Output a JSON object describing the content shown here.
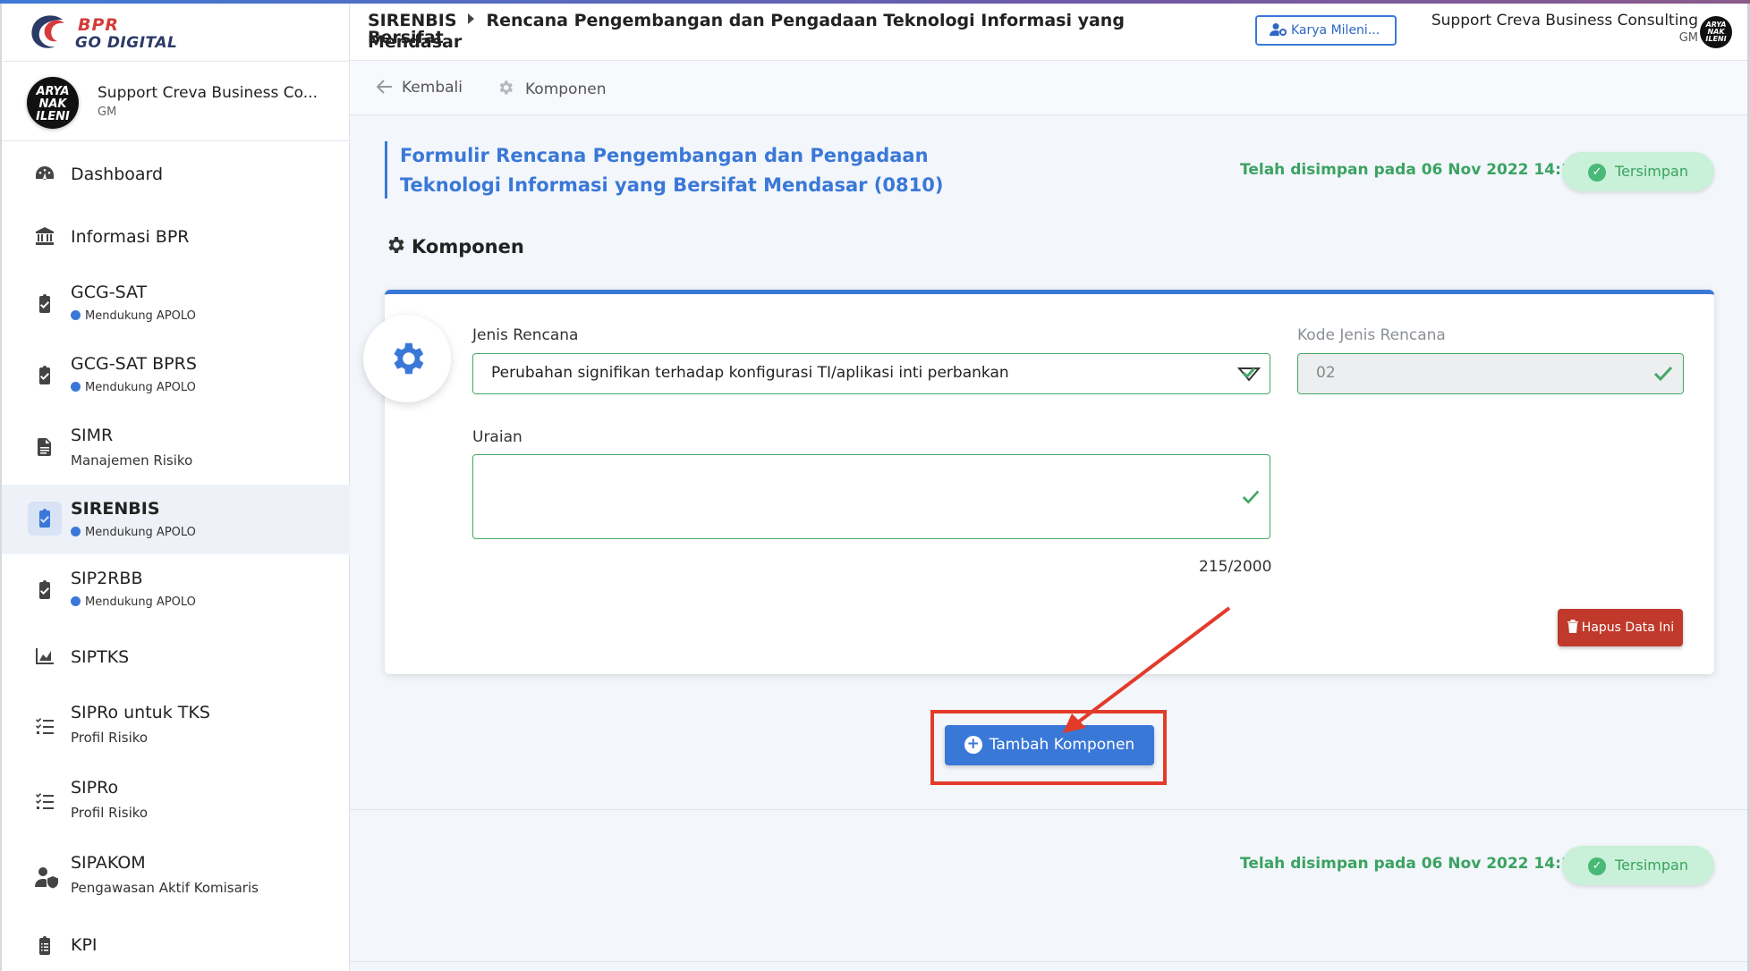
{
  "app": {
    "logo_line1": "BPR",
    "logo_line2": "GO DIGITAL"
  },
  "header": {
    "breadcrumb_root": "SIRENBIS",
    "breadcrumb_title_line1": "Rencana Pengembangan dan Pengadaan Teknologi Informasi yang Bersifat",
    "breadcrumb_title_line2": "Mendasar",
    "org_button": "Karya Mileni...",
    "user_name": "Support Creva Business Consulting",
    "user_role": "GM",
    "avatar_text": "ARYA NAK ILENI"
  },
  "sidebar": {
    "profile_name": "Support Creva Business Co...",
    "profile_role": "GM",
    "avatar_text": "ARYA NAK ILENI",
    "items": [
      {
        "label": "Dashboard",
        "icon": "dashboard-icon"
      },
      {
        "label": "Informasi BPR",
        "icon": "bank-icon"
      },
      {
        "label": "GCG-SAT",
        "sub": "Mendukung APOLO",
        "icon": "clipboard-check-icon"
      },
      {
        "label": "GCG-SAT BPRS",
        "sub": "Mendukung APOLO",
        "icon": "clipboard-check-icon"
      },
      {
        "label": "SIMR",
        "sub": "Manajemen Risiko",
        "icon": "document-icon"
      },
      {
        "label": "SIRENBIS",
        "sub": "Mendukung APOLO",
        "icon": "clipboard-check-icon"
      },
      {
        "label": "SIP2RBB",
        "sub": "Mendukung APOLO",
        "icon": "clipboard-check-icon"
      },
      {
        "label": "SIPTKS",
        "icon": "area-chart-icon"
      },
      {
        "label": "SIPRo untuk TKS",
        "sub": "Profil Risiko",
        "icon": "checklist-icon"
      },
      {
        "label": "SIPRo",
        "sub": "Profil Risiko",
        "icon": "checklist-icon"
      },
      {
        "label": "SIPAKOM",
        "sub": "Pengawasan Aktif Komisaris",
        "icon": "user-shield-icon"
      },
      {
        "label": "KPI",
        "icon": "clipboard-list-icon"
      }
    ]
  },
  "subnav": {
    "back": "Kembali",
    "current": "Komponen"
  },
  "form": {
    "title": "Formulir Rencana Pengembangan dan Pengadaan Teknologi Informasi yang Bersifat Mendasar (0810)",
    "saved_text": "Telah disimpan pada 06 Nov 2022 14:11",
    "saved_button": "Tersimpan",
    "section_title": "Komponen",
    "jenis_label": "Jenis Rencana",
    "jenis_value": "Perubahan signifikan terhadap konfigurasi TI/aplikasi inti perbankan",
    "kode_label": "Kode Jenis Rencana",
    "kode_value": "02",
    "uraian_label": "Uraian",
    "uraian_value": "",
    "counter": "215/2000",
    "delete_button": "Hapus Data Ini",
    "add_button": "Tambah Komponen"
  },
  "footer": {
    "saved_text": "Telah disimpan pada 06 Nov 2022 14:11",
    "saved_button": "Tersimpan"
  },
  "colors": {
    "primary": "#3a78d8",
    "success": "#3aa361",
    "danger": "#c0392b",
    "highlight": "#e23b2a"
  }
}
